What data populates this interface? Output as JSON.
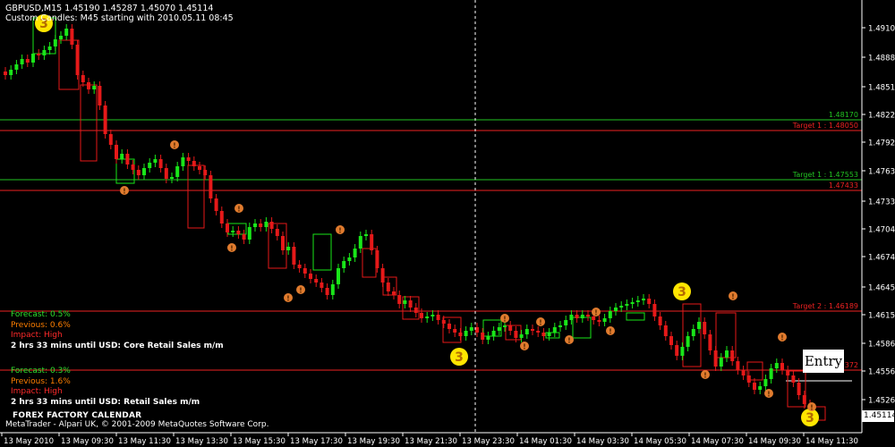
{
  "header": {
    "symbol_line": "GBPUSD,M15  1.45190 1.45287 1.45070 1.45114",
    "custom_line": "Custom Candles: M45 starting with 2010.05.11 08:45"
  },
  "price_axis": {
    "labels": [
      "1.49105",
      "1.48880",
      "1.48515",
      "1.48220",
      "1.47925",
      "1.47630",
      "1.47335",
      "1.47040",
      "1.46745",
      "1.46450",
      "1.46155",
      "1.45860",
      "1.45560",
      "1.45265"
    ],
    "current_price": "1.45114"
  },
  "time_axis": {
    "labels": [
      "13 May 2010",
      "13 May 09:30",
      "13 May 11:30",
      "13 May 13:30",
      "13 May 15:30",
      "13 May 17:30",
      "13 May 19:30",
      "13 May 21:30",
      "13 May 23:30",
      "14 May 01:30",
      "14 May 03:30",
      "14 May 05:30",
      "14 May 07:30",
      "14 May 09:30",
      "14 May 11:30"
    ]
  },
  "levels": [
    {
      "label": "1.48170",
      "color": "#22c322",
      "kind": "green"
    },
    {
      "label": "Target 1 : 1.48050",
      "color": "#e22",
      "kind": "red"
    },
    {
      "label": "Target 1 : 1.47553",
      "color": "#22c322",
      "kind": "green"
    },
    {
      "label": "1.47433",
      "color": "#e22",
      "kind": "red"
    },
    {
      "label": "Target 2 : 1.46189",
      "color": "#e22",
      "kind": "red"
    },
    {
      "label": "...372",
      "color": "#e22",
      "kind": "red"
    }
  ],
  "events": [
    {
      "forecast": "Forecast: 0.5%",
      "previous": "Previous: 0.6%",
      "impact": "Impact: High",
      "title": "2 hrs 33 mins until USD: Core Retail Sales m/m"
    },
    {
      "forecast": "Forecast: 0.3%",
      "previous": "Previous: 1.6%",
      "impact": "Impact: High",
      "title": "2 hrs 33 mins until USD: Retail Sales m/m"
    }
  ],
  "calendar_label": "FOREX FACTORY CALENDAR",
  "copyright": "MetaTrader - Alpari UK, © 2001-2009 MetaQuotes Software Corp.",
  "entry_label": "Entry",
  "markers": {
    "three": "3",
    "exclamation": "!"
  },
  "colors": {
    "bull": "#19e619",
    "bear": "#e61919",
    "background": "#000000"
  }
}
